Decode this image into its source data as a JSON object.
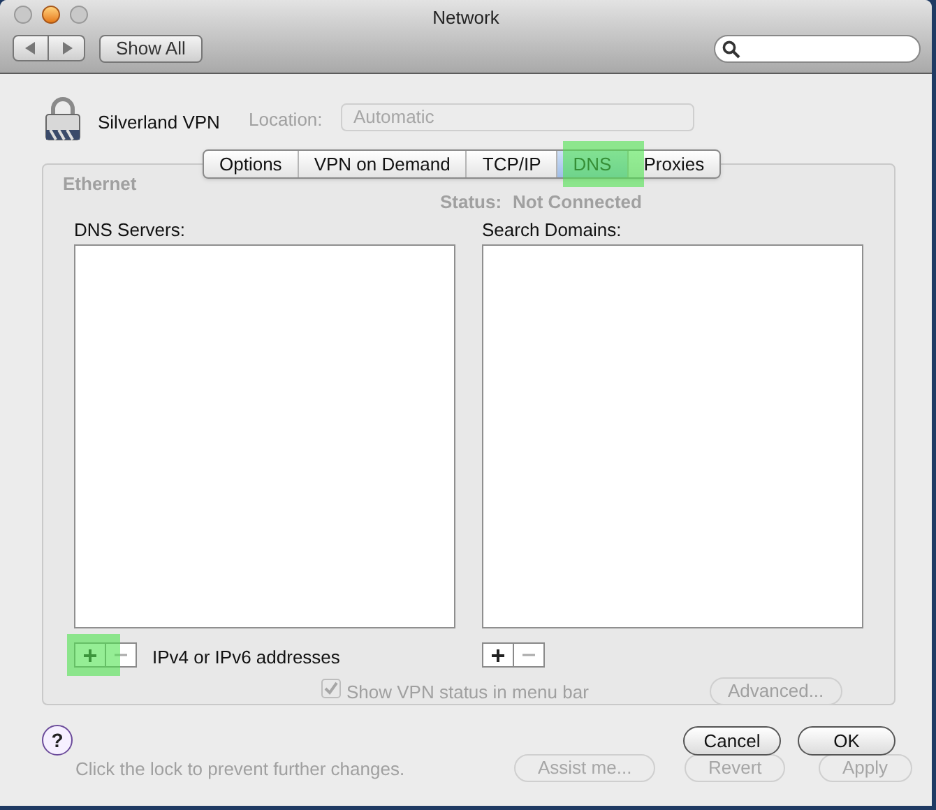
{
  "window": {
    "title": "Network",
    "show_all": "Show All"
  },
  "background": {
    "location_label": "Location:",
    "location_value": "Automatic",
    "service": "Ethernet",
    "status_label": "Status:",
    "status_value": "Not Connected",
    "show_status": "Show VPN status in menu bar",
    "show_status_checked": true,
    "advanced": "Advanced...",
    "lock_message": "Click the lock to prevent further changes.",
    "assist": "Assist me...",
    "revert": "Revert",
    "apply": "Apply"
  },
  "sheet": {
    "service_name": "Silverland VPN",
    "tabs": [
      {
        "label": "Options",
        "selected": false,
        "highlighted": false
      },
      {
        "label": "VPN on Demand",
        "selected": false,
        "highlighted": false
      },
      {
        "label": "TCP/IP",
        "selected": false,
        "highlighted": false
      },
      {
        "label": "DNS",
        "selected": true,
        "highlighted": true
      },
      {
        "label": "Proxies",
        "selected": false,
        "highlighted": false
      }
    ],
    "lists": [
      {
        "label": "DNS Servers:",
        "add_highlighted": true,
        "hint": "IPv4 or IPv6 addresses"
      },
      {
        "label": "Search Domains:",
        "add_highlighted": false
      }
    ],
    "help": "?",
    "buttons": [
      {
        "label": "Cancel",
        "default": false
      },
      {
        "label": "OK",
        "default": false
      }
    ]
  }
}
